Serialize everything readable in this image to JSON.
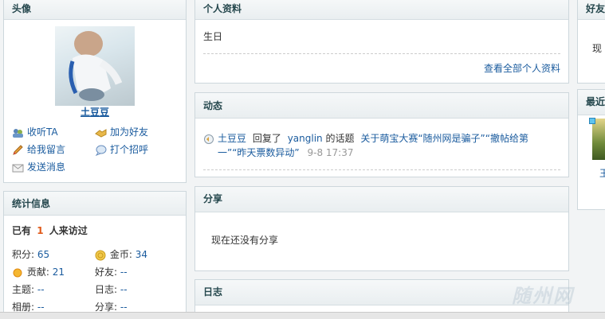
{
  "left": {
    "avatar_panel": {
      "title": "头像",
      "username": "土豆豆",
      "actions": [
        {
          "label": "收听TA",
          "icon": "follow-icon"
        },
        {
          "label": "加为好友",
          "icon": "handshake-icon"
        },
        {
          "label": "给我留言",
          "icon": "pencil-icon"
        },
        {
          "label": "打个招呼",
          "icon": "greet-icon"
        },
        {
          "label": "发送消息",
          "icon": "envelope-icon"
        }
      ]
    },
    "stats_panel": {
      "title": "统计信息",
      "visitors_prefix": "已有",
      "visitors_count": "1",
      "visitors_suffix": "人来访过",
      "items": [
        {
          "label": "积分:",
          "value": "65"
        },
        {
          "label": "金币:",
          "value": "34"
        },
        {
          "label": "贡献:",
          "value": "21"
        },
        {
          "label": "好友:",
          "value": "--"
        },
        {
          "label": "主题:",
          "value": "--"
        },
        {
          "label": "日志:",
          "value": "--"
        },
        {
          "label": "相册:",
          "value": "--"
        },
        {
          "label": "分享:",
          "value": "--"
        }
      ]
    }
  },
  "main": {
    "profile": {
      "title": "个人资料",
      "field": "生日",
      "view_all": "查看全部个人资料"
    },
    "activity": {
      "title": "动态",
      "user": "土豆豆",
      "verb": "回复了",
      "target_user": "yanglin",
      "of_topic": "的话题",
      "topic_line1": "关于萌宝大赛“随州网是骗子”“撤帖给第",
      "topic_line2": "一”“昨天票数异动”",
      "time": "9-8 17:37"
    },
    "share": {
      "title": "分享",
      "empty": "现在还没有分享"
    },
    "blog": {
      "title": "日志"
    }
  },
  "right": {
    "friends": {
      "title": "好友",
      "text": "现"
    },
    "recent": {
      "title": "最近",
      "name": "王"
    }
  },
  "watermark": "随州网"
}
